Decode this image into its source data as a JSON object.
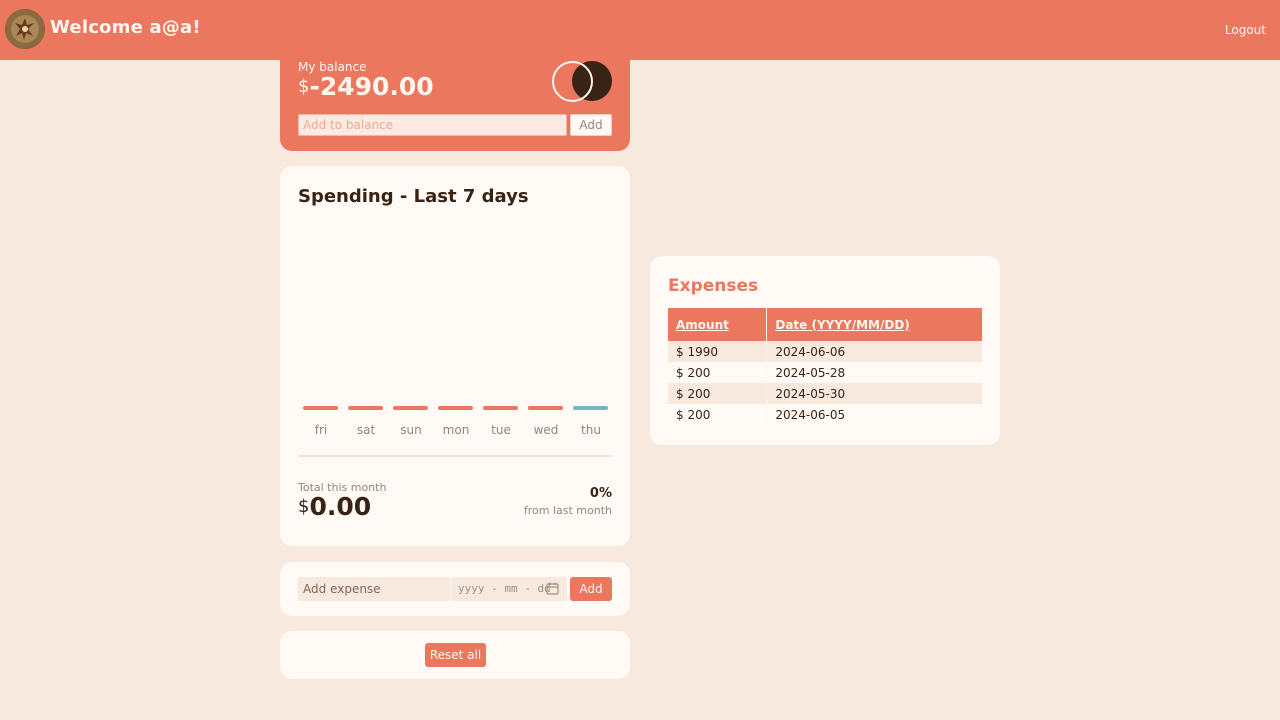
{
  "header": {
    "welcome": "Welcome a@a!",
    "logout": "Logout"
  },
  "balance": {
    "label": "My balance",
    "currency": "$",
    "value": "-2490.00",
    "input_placeholder": "Add to balance",
    "add_label": "Add"
  },
  "spending": {
    "title": "Spending - Last 7 days",
    "days": [
      "fri",
      "sat",
      "sun",
      "mon",
      "tue",
      "wed",
      "thu"
    ],
    "highlight_day": "thu",
    "total_label": "Total this month",
    "total_currency": "$",
    "total_value": "0.00",
    "percent": "0%",
    "percent_label": "from last month"
  },
  "add_expense": {
    "placeholder": "Add expense",
    "date_placeholder": "yyyy - mm - dd",
    "add_label": "Add"
  },
  "reset": {
    "label": "Reset all"
  },
  "expenses": {
    "title": "Expenses",
    "columns": [
      "Amount",
      "Date (YYYY/MM/DD)"
    ],
    "rows": [
      [
        "$ 1990",
        "2024-06-06"
      ],
      [
        "$ 200",
        "2024-05-28"
      ],
      [
        "$ 200",
        "2024-05-30"
      ],
      [
        "$ 200",
        "2024-06-05"
      ]
    ]
  },
  "colors": {
    "accent": "#ec775f",
    "background": "#f7e9de",
    "card": "#fffaf5",
    "dark": "#382314",
    "highlight_bar": "#76b5bc"
  }
}
